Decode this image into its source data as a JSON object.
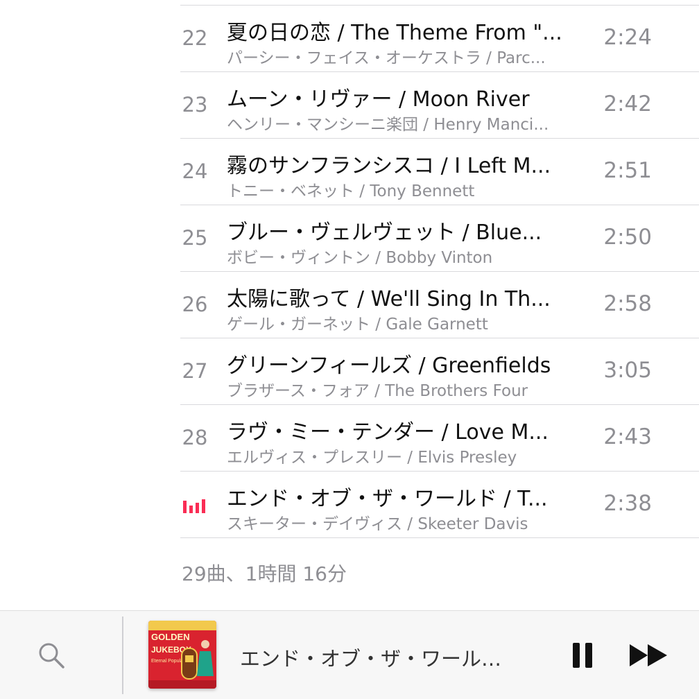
{
  "tracks": [
    {
      "number": "22",
      "title": "夏の日の恋 / The Theme From \"...",
      "artist": "パーシー・フェイス・オーケストラ / Parc...",
      "duration": "2:24"
    },
    {
      "number": "23",
      "title": "ムーン・リヴァー / Moon River",
      "artist": "ヘンリー・マンシーニ楽団 / Henry Manci...",
      "duration": "2:42"
    },
    {
      "number": "24",
      "title": "霧のサンフランシスコ / I Left M...",
      "artist": "トニー・ベネット / Tony Bennett",
      "duration": "2:51"
    },
    {
      "number": "25",
      "title": "ブルー・ヴェルヴェット / Blue...",
      "artist": "ボビー・ヴィントン / Bobby Vinton",
      "duration": "2:50"
    },
    {
      "number": "26",
      "title": "太陽に歌って / We'll Sing In Th...",
      "artist": "ゲール・ガーネット / Gale Garnett",
      "duration": "2:58"
    },
    {
      "number": "27",
      "title": "グリーンフィールズ / Greenfields",
      "artist": "ブラザース・フォア / The Brothers Four",
      "duration": "3:05"
    },
    {
      "number": "28",
      "title": "ラヴ・ミー・テンダー / Love M...",
      "artist": "エルヴィス・プレスリー / Elvis Presley",
      "duration": "2:43"
    },
    {
      "number": "",
      "playing_icon": "equalizer-icon",
      "title": "エンド・オブ・ザ・ワールド / T...",
      "artist": "スキーター・デイヴィス / Skeeter Davis",
      "duration": "2:38"
    }
  ],
  "summary": "29曲、1時間 16分",
  "mini_player": {
    "search_icon": "search-icon",
    "now_playing_title": "エンド・オブ・ザ・ワール…",
    "album_art": {
      "lines": [
        "GOLDEN",
        "JUKEBOX",
        "Eternal Popular Hits"
      ]
    },
    "pause_icon": "pause-icon",
    "next_icon": "fast-forward-icon"
  },
  "colors": {
    "accent": "#fa2d55",
    "secondary_text": "#8e8e93",
    "primary_text": "#111111",
    "divider": "#d9d9dd",
    "mini_player_bg": "#f7f7f7"
  }
}
